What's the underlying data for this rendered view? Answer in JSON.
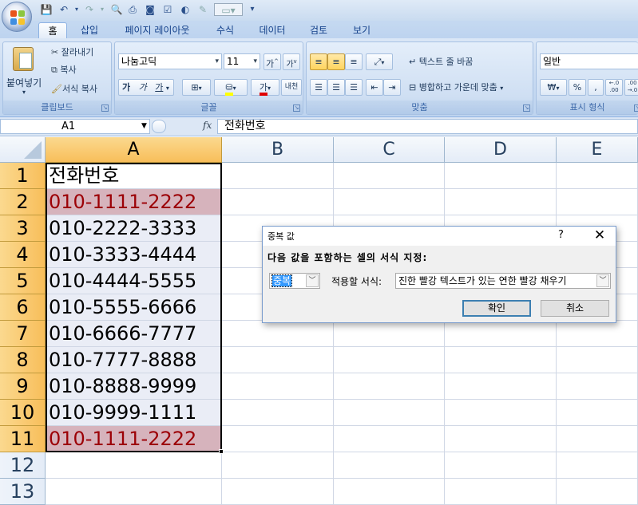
{
  "qat": {
    "customize": "▾"
  },
  "tabs": [
    "홈",
    "삽입",
    "페이지 레이아웃",
    "수식",
    "데이터",
    "검토",
    "보기"
  ],
  "ribbon": {
    "clipboard": {
      "paste": "붙여넣기",
      "cut": "잘라내기",
      "copy": "복사",
      "format_painter": "서식 복사",
      "label": "클립보드"
    },
    "font": {
      "font_name": "나눔고딕",
      "font_size": "11",
      "grow": "가",
      "shrink": "가",
      "bold": "가",
      "italic": "가",
      "underline": "가",
      "font_color": "가",
      "phonetic": "내천",
      "label": "글꼴"
    },
    "alignment": {
      "wrap_text": "텍스트 줄 바꿈",
      "merge_center": "병합하고 가운데 맞춤",
      "label": "맞춤"
    },
    "number": {
      "format": "일반",
      "currency": "₩",
      "percent": "%",
      "comma": ",",
      "inc_dec": "←.0 .00",
      "dec_dec": ".00 →.0",
      "label": "표시 형식"
    }
  },
  "formula_bar": {
    "cell_ref": "A1",
    "fx": "fx",
    "content": "전화번호"
  },
  "columns": [
    "A",
    "B",
    "C",
    "D",
    "E"
  ],
  "rows": [
    "1",
    "2",
    "3",
    "4",
    "5",
    "6",
    "7",
    "8",
    "9",
    "10",
    "11",
    "12",
    "13"
  ],
  "cells_a": [
    "전화번호",
    "010-1111-2222",
    "010-2222-3333",
    "010-3333-4444",
    "010-4444-5555",
    "010-5555-6666",
    "010-6666-7777",
    "010-7777-8888",
    "010-8888-9999",
    "010-9999-1111",
    "010-1111-2222"
  ],
  "dialog": {
    "title": "중복 값",
    "help": "?",
    "close": "✕",
    "prompt": "다음 값을 포함하는 셀의 서식 지정:",
    "type_value": "중복",
    "format_label": "적용할 서식:",
    "format_value": "진한 빨강 텍스트가 있는 연한 빨강 채우기",
    "ok": "확인",
    "cancel": "취소"
  },
  "colors": {
    "duplicate_fill": "#d6b3bc",
    "duplicate_text": "#9c0006",
    "selected_header": "#f8be5a"
  }
}
